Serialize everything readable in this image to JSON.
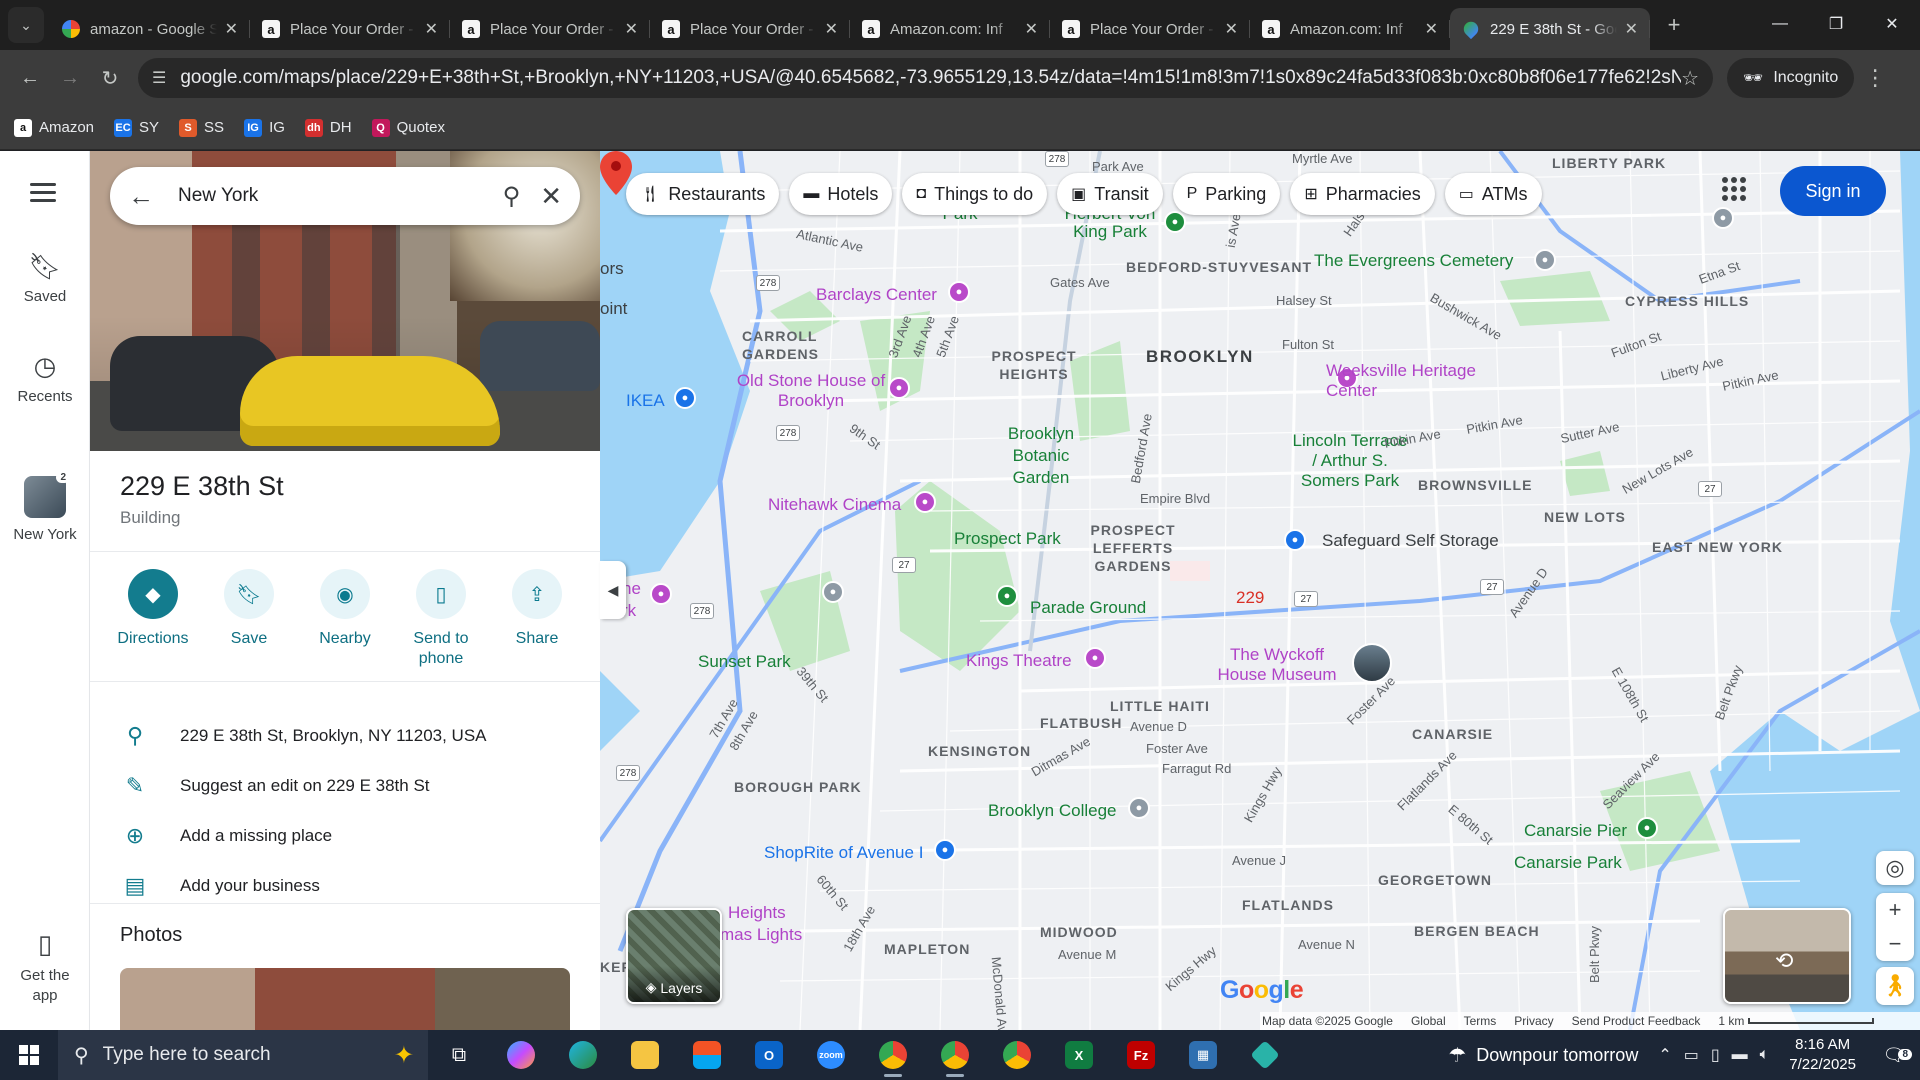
{
  "browser": {
    "tabs": [
      {
        "title": "amazon - Google Search",
        "icon": "google-icon",
        "active": false
      },
      {
        "title": "Place Your Order - Amazon",
        "icon": "amazon-icon",
        "active": false
      },
      {
        "title": "Place Your Order - Amazon",
        "icon": "amazon-icon",
        "active": false
      },
      {
        "title": "Place Your Order - Amazon",
        "icon": "amazon-icon",
        "active": false
      },
      {
        "title": "Amazon.com: Inf",
        "icon": "amazon-icon",
        "active": false
      },
      {
        "title": "Place Your Order - Amazon",
        "icon": "amazon-icon",
        "active": false
      },
      {
        "title": "Amazon.com: Inf",
        "icon": "amazon-icon",
        "active": false
      },
      {
        "title": "229 E 38th St - Google Maps",
        "icon": "maps-icon",
        "active": true
      }
    ],
    "url": "google.com/maps/place/229+E+38th+St,+Brooklyn,+NY+11203,+USA/@40.6545682,-73.9655129,13.54z/data=!4m15!1m8!3m7!1s0x89c24fa5d33f083b:0xc80b8f06e177fe62!2sNew+York,+...",
    "incognito_label": "Incognito",
    "bookmarks": [
      {
        "label": "Amazon",
        "icon": "amazon-icon"
      },
      {
        "label": "SY",
        "icon": "ec-icon"
      },
      {
        "label": "SS",
        "icon": "ss-icon"
      },
      {
        "label": "IG",
        "icon": "ig-icon"
      },
      {
        "label": "DH",
        "icon": "dh-icon"
      },
      {
        "label": "Quotex",
        "icon": "quotex-icon"
      }
    ]
  },
  "rail": {
    "saved": "Saved",
    "recents": "Recents",
    "new_york": "New York",
    "new_york_badge": "2",
    "get_app": "Get the app"
  },
  "panel": {
    "search_value": "New York",
    "place_title": "229 E 38th St",
    "place_type": "Building",
    "actions": [
      {
        "label": "Directions",
        "icon": "directions-icon"
      },
      {
        "label": "Save",
        "icon": "bookmark-icon"
      },
      {
        "label": "Nearby",
        "icon": "nearby-icon"
      },
      {
        "label": "Send to phone",
        "icon": "send-to-phone-icon"
      },
      {
        "label": "Share",
        "icon": "share-icon"
      }
    ],
    "info": [
      {
        "text": "229 E 38th St, Brooklyn, NY 11203, USA",
        "icon": "location-pin-icon"
      },
      {
        "text": "Suggest an edit on 229 E 38th St",
        "icon": "pencil-icon"
      },
      {
        "text": "Add a missing place",
        "icon": "add-place-icon"
      },
      {
        "text": "Add your business",
        "icon": "add-business-icon"
      }
    ],
    "photos_heading": "Photos"
  },
  "map": {
    "chips": [
      {
        "label": "Restaurants",
        "icon": "fork-knife-icon"
      },
      {
        "label": "Hotels",
        "icon": "bed-icon"
      },
      {
        "label": "Things to do",
        "icon": "camera-icon"
      },
      {
        "label": "Transit",
        "icon": "train-icon"
      },
      {
        "label": "Parking",
        "icon": "parking-icon"
      },
      {
        "label": "Pharmacies",
        "icon": "pharmacy-icon"
      },
      {
        "label": "ATMs",
        "icon": "atm-icon"
      }
    ],
    "sign_in": "Sign in",
    "pin_label": "229",
    "layers_label": "Layers",
    "labels": {
      "brooklyn": "BROOKLYN",
      "fort_greene": "Fort Greene Park",
      "herbert": "Herbert Von King Park",
      "bed_stuy": "BEDFORD-STUYVESANT",
      "evergreens": "The Evergreens Cemetery",
      "liberty_park": "LIBERTY PARK",
      "cypress_hills": "CYPRESS HILLS",
      "barclays": "Barclays Center",
      "carroll_gardens": "CARROLL GARDENS",
      "prospect_heights": "PROSPECT HEIGHTS",
      "old_stone": "Old Stone House of Brooklyn",
      "ikea": "IKEA",
      "weeksville": "Weeksville Heritage Center",
      "botanic": "Brooklyn Botanic Garden",
      "lincoln": "Lincoln Terrace / Arthur S. Somers Park",
      "brownsville": "BROWNSVILLE",
      "nitehawk": "Nitehawk Cinema",
      "prospect_park": "Prospect Park",
      "prospect_lefferts": "PROSPECT LEFFERTS GARDENS",
      "safeguard": "Safeguard Self Storage",
      "new_lots": "NEW LOTS",
      "east_ny": "EAST NEW YORK",
      "parade": "Parade Ground",
      "wyckoff": "The Wyckoff House Museum",
      "kings_theatre": "Kings Theatre",
      "sunset_park": "Sunset Park",
      "little_haiti": "LITTLE HAITI",
      "flatbush": "FLATBUSH",
      "kensington": "KENSINGTON",
      "canarsie": "CANARSIE",
      "borough_park": "BOROUGH PARK",
      "brooklyn_college": "Brooklyn College",
      "shoprite": "ShopRite of Avenue I",
      "canarsie_pier": "Canarsie Pier",
      "canarsie_park": "Canarsie Park",
      "georgetown": "GEORGETOWN",
      "heights": "Heights",
      "mas_lights": "mas Lights",
      "flatlands": "FLATLANDS",
      "midwood": "MIDWOOD",
      "mapleton": "MAPLETON",
      "bergen_beach": "BERGEN BEACH",
      "ker": "KER",
      "rk": "rk",
      "ne": "ne",
      "ors": "ors",
      "oint": "oint"
    },
    "roads": {
      "myrtle": "Myrtle Ave",
      "park_ave": "Park Ave",
      "atlantic": "Atlantic Ave",
      "gates": "Gates Ave",
      "halsey": "Halsey St",
      "fulton": "Fulton St",
      "fulton2": "Fulton St",
      "bushwick": "Bushwick Ave",
      "liberty_ave": "Liberty Ave",
      "pitkin": "Pitkin Ave",
      "pitkin2": "Pitkin Ave",
      "pitkin3": "Pitkin Ave",
      "sutter": "Sutter Ave",
      "new_lots_ave": "New Lots Ave",
      "etna": "Etna St",
      "third": "3rd Ave",
      "fourth": "4th Ave",
      "fifth": "5th Ave",
      "ninth": "9th St",
      "bedford": "Bedford Ave",
      "empire": "Empire Blvd",
      "seventh": "7th Ave",
      "eighth": "8th Ave",
      "thirty_ninth": "39th St",
      "avenue_d": "Avenue D",
      "avenue_d2": "Avenue D",
      "foster": "Foster Ave",
      "foster2": "Foster Ave",
      "farragut": "Farragut Rd",
      "ditmas": "Ditmas Ave",
      "kings_hwy": "Kings Hwy",
      "kings_hwy2": "Kings Hwy",
      "flatlands_ave": "Flatlands Ave",
      "e80": "E 80th St",
      "e108": "E 108th St",
      "seaview": "Seaview Ave",
      "belt": "Belt Pkwy",
      "belt2": "Belt Pkwy",
      "sixtieth": "60th St",
      "eighteenth": "18th Ave",
      "avenue_j": "Avenue J",
      "avenue_m": "Avenue M",
      "avenue_n": "Avenue N",
      "mcdonald": "McDonald Ave",
      "hwy": "is Ave",
      "halsey_st": "Halsey"
    },
    "shields": [
      "278",
      "278",
      "278",
      "278",
      "278",
      "27",
      "27",
      "27",
      "27"
    ],
    "attribution": {
      "map_data": "Map data ©2025 Google",
      "global": "Global",
      "terms": "Terms",
      "privacy": "Privacy",
      "feedback": "Send Product Feedback",
      "scale": "1 km"
    },
    "google_logo": [
      "G",
      "o",
      "o",
      "g",
      "l",
      "e"
    ]
  },
  "taskbar": {
    "search_placeholder": "Type here to search",
    "weather": "Downpour tomorrow",
    "time": "8:16 AM",
    "date": "7/22/2025",
    "notifications": "8"
  }
}
